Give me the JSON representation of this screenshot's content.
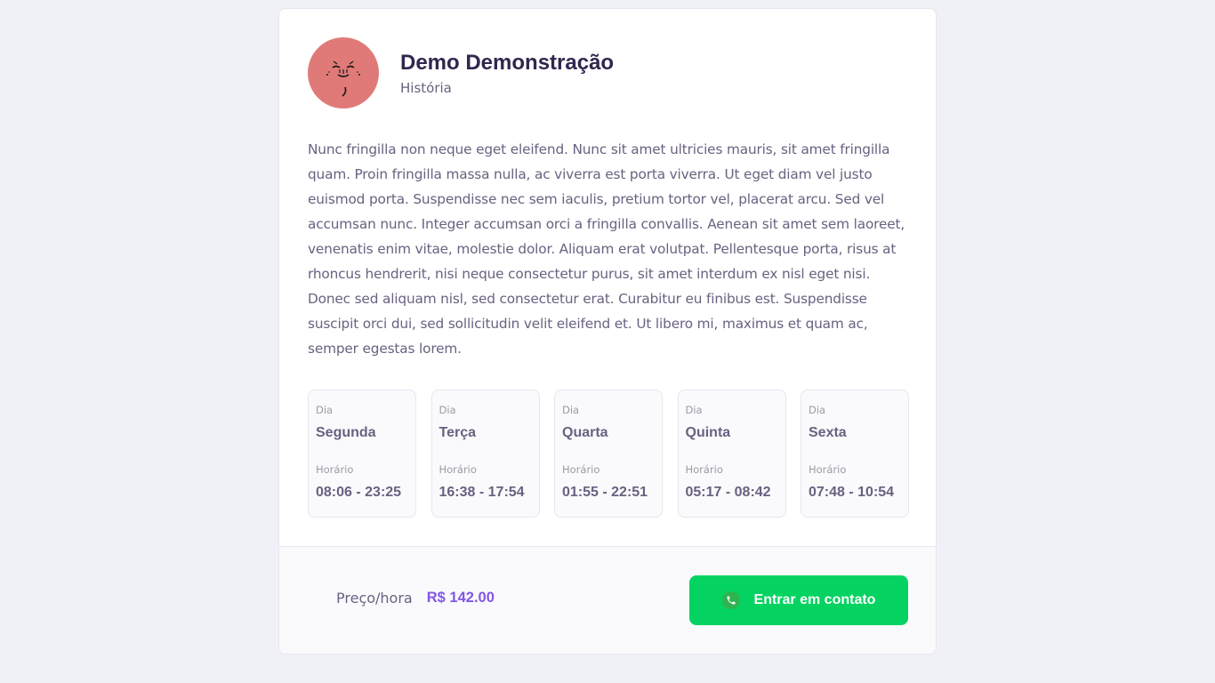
{
  "teacher": {
    "name": "Demo Demonstração",
    "subject": "História",
    "avatar_icon": "cartoon-face-avatar",
    "bio": "Nunc fringilla non neque eget eleifend. Nunc sit amet ultricies mauris, sit amet fringilla quam. Proin fringilla massa nulla, ac viverra est porta viverra. Ut eget diam vel justo euismod porta. Suspendisse nec sem iaculis, pretium tortor vel, placerat arcu. Sed vel accumsan nunc. Integer accumsan orci a fringilla convallis. Aenean sit amet sem laoreet, venenatis enim vitae, molestie dolor. Aliquam erat volutpat. Pellentesque porta, risus at rhoncus hendrerit, nisi neque consectetur purus, sit amet interdum ex nisl eget nisi. Donec sed aliquam nisl, sed consectetur erat. Curabitur eu finibus est. Suspendisse suscipit orci dui, sed sollicitudin velit eleifend et. Ut libero mi, maximus et quam ac, semper egestas lorem."
  },
  "schedule": [
    {
      "day_label": "Dia",
      "day": "Segunda",
      "time_label": "Horário",
      "time": "08:06 - 23:25"
    },
    {
      "day_label": "Dia",
      "day": "Terça",
      "time_label": "Horário",
      "time": "16:38 - 17:54"
    },
    {
      "day_label": "Dia",
      "day": "Quarta",
      "time_label": "Horário",
      "time": "01:55 - 22:51"
    },
    {
      "day_label": "Dia",
      "day": "Quinta",
      "time_label": "Horário",
      "time": "05:17 - 08:42"
    },
    {
      "day_label": "Dia",
      "day": "Sexta",
      "time_label": "Horário",
      "time": "07:48 - 10:54"
    }
  ],
  "footer": {
    "price_label": "Preço/hora",
    "price_value": "R$ 142.00",
    "contact_label": "Entrar em contato",
    "contact_icon": "whatsapp-icon"
  },
  "colors": {
    "background": "#f0f0f7",
    "primary": "#8257e5",
    "contact_green": "#04d361",
    "title_text": "#32264d",
    "body_text": "#6a6180",
    "avatar_bg": "#e07a78"
  }
}
